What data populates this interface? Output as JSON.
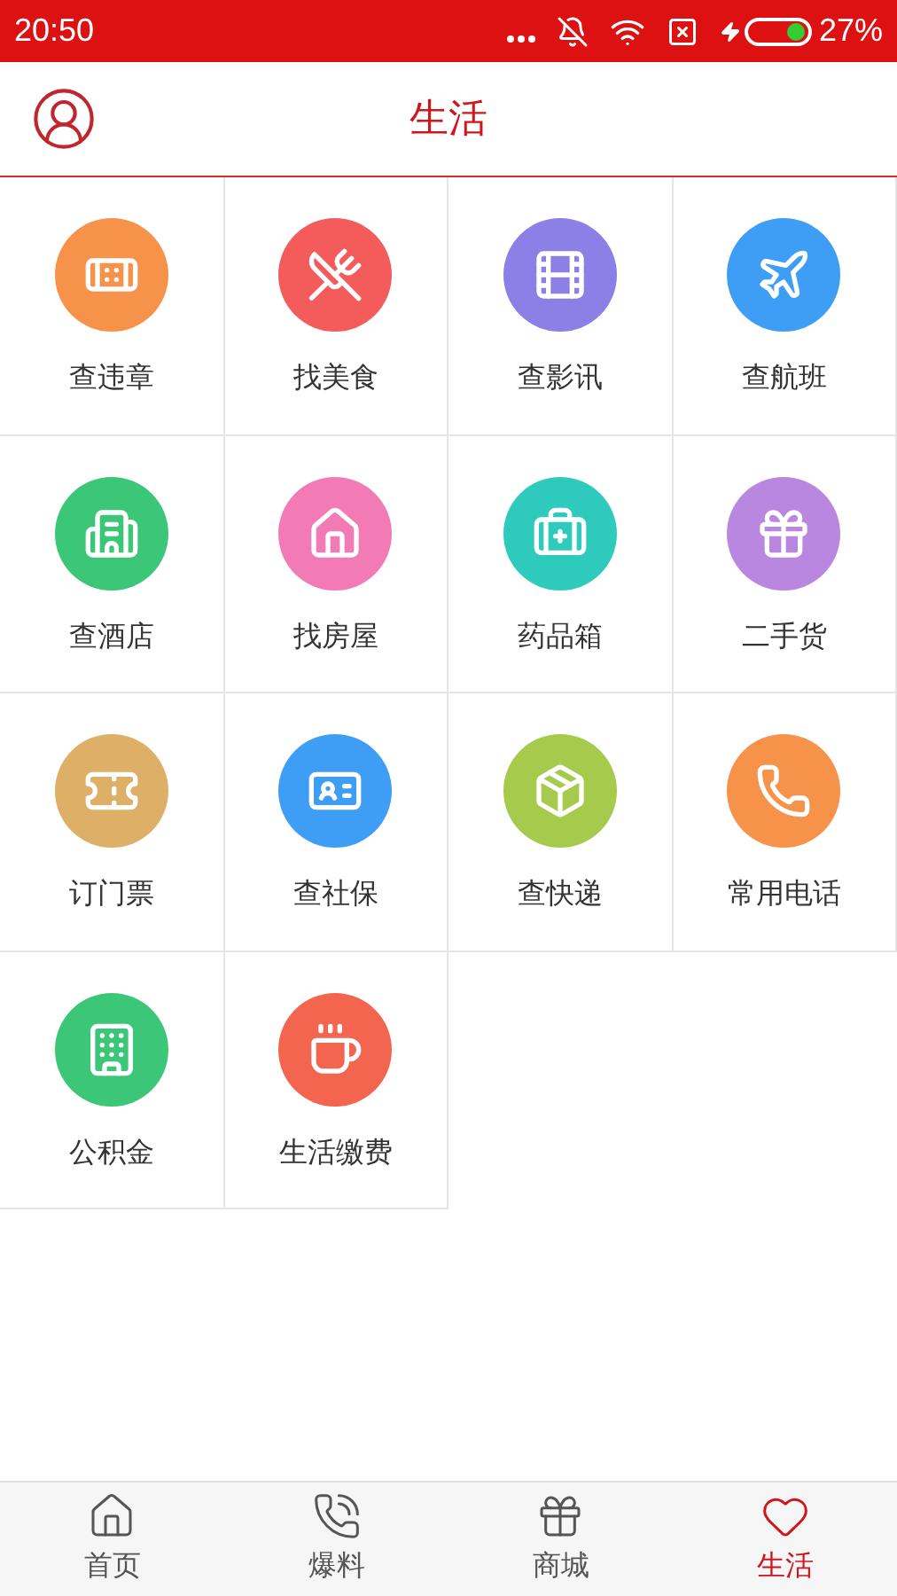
{
  "status_bar": {
    "time": "20:50",
    "battery": "27%"
  },
  "header": {
    "title": "生活"
  },
  "tiles": [
    {
      "label": "查违章",
      "kind": "bandage",
      "color": "#f7924a"
    },
    {
      "label": "找美食",
      "kind": "dining",
      "color": "#f45b5b"
    },
    {
      "label": "查影讯",
      "kind": "film",
      "color": "#8c7fe6"
    },
    {
      "label": "查航班",
      "kind": "plane",
      "color": "#3e9ef5"
    },
    {
      "label": "查酒店",
      "kind": "hotel",
      "color": "#3cc677"
    },
    {
      "label": "找房屋",
      "kind": "house",
      "color": "#f27bb6"
    },
    {
      "label": "药品箱",
      "kind": "medkit",
      "color": "#2ecbbd"
    },
    {
      "label": "二手货",
      "kind": "gift",
      "color": "#b987e0"
    },
    {
      "label": "订门票",
      "kind": "ticket",
      "color": "#deb067"
    },
    {
      "label": "查社保",
      "kind": "card",
      "color": "#3e9ef5"
    },
    {
      "label": "查快递",
      "kind": "package",
      "color": "#a6cb4c"
    },
    {
      "label": "常用电话",
      "kind": "phone",
      "color": "#f7924a"
    },
    {
      "label": "公积金",
      "kind": "city",
      "color": "#3cc677"
    },
    {
      "label": "生活缴费",
      "kind": "coffee",
      "color": "#f4654f"
    }
  ],
  "tab_bar": [
    {
      "label": "首页",
      "kind": "home",
      "selected": false
    },
    {
      "label": "爆料",
      "kind": "call",
      "selected": false
    },
    {
      "label": "商城",
      "kind": "gift",
      "selected": false
    },
    {
      "label": "生活",
      "kind": "heart",
      "selected": true
    }
  ]
}
